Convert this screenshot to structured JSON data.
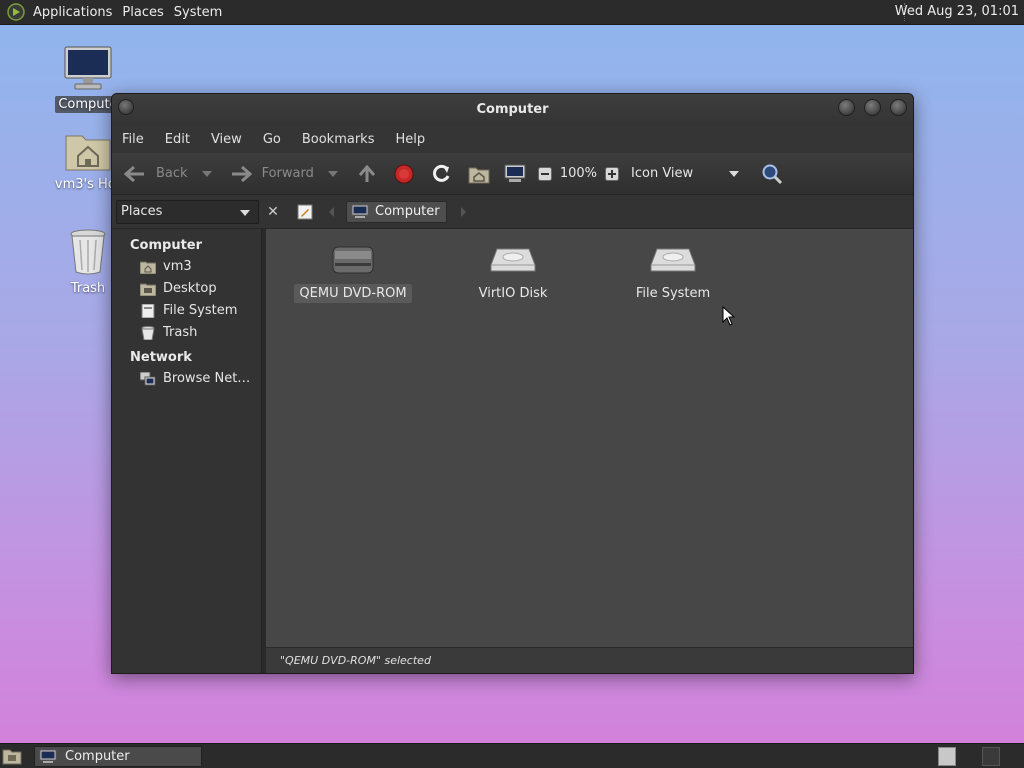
{
  "top_panel": {
    "menus": [
      "Applications",
      "Places",
      "System"
    ],
    "clock": "Wed Aug 23, 01:01"
  },
  "desktop": {
    "icons": [
      {
        "label": "Compute",
        "icon": "computer-icon",
        "selected": true
      },
      {
        "label": "vm3's Hor",
        "icon": "home-folder-icon"
      },
      {
        "label": "Trash",
        "icon": "trash-icon"
      }
    ]
  },
  "window": {
    "title": "Computer",
    "menubar": [
      "File",
      "Edit",
      "View",
      "Go",
      "Bookmarks",
      "Help"
    ],
    "toolbar": {
      "back": "Back",
      "forward": "Forward",
      "zoom": "100%",
      "view_mode": "Icon View"
    },
    "location": {
      "places_combo": "Places",
      "current": "Computer"
    },
    "sidebar": {
      "sections": [
        {
          "header": "Computer",
          "items": [
            {
              "label": "vm3",
              "icon": "home-icon"
            },
            {
              "label": "Desktop",
              "icon": "desktop-folder-icon"
            },
            {
              "label": "File System",
              "icon": "filesystem-icon"
            },
            {
              "label": "Trash",
              "icon": "trash-icon"
            }
          ]
        },
        {
          "header": "Network",
          "items": [
            {
              "label": "Browse Net…",
              "icon": "network-icon"
            }
          ]
        }
      ]
    },
    "files": [
      {
        "label": "QEMU DVD-ROM",
        "icon": "optical-drive-icon",
        "selected": true
      },
      {
        "label": "VirtIO Disk",
        "icon": "harddisk-icon"
      },
      {
        "label": "File System",
        "icon": "harddisk-icon"
      }
    ],
    "status": "\"QEMU DVD-ROM\" selected"
  },
  "bottom_panel": {
    "task": "Computer"
  }
}
